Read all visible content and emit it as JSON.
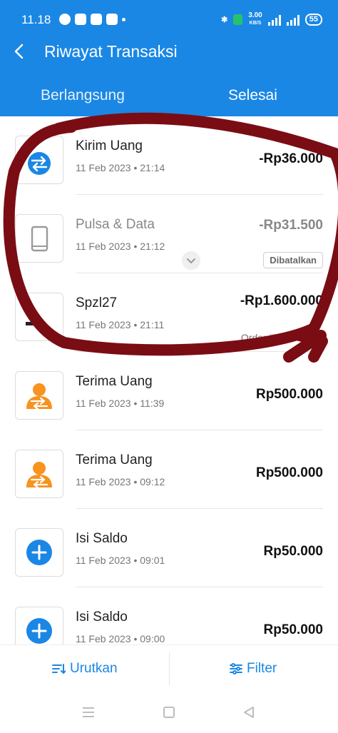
{
  "status": {
    "time": "11.18",
    "speed_top": "3.00",
    "speed_unit": "KB/S",
    "battery": "55"
  },
  "header": {
    "title": "Riwayat Transaksi",
    "tabs": [
      {
        "label": "Berlangsung"
      },
      {
        "label": "Selesai"
      }
    ]
  },
  "transactions": [
    {
      "name": "Kirim Uang",
      "date": "11 Feb 2023 • 21:14",
      "amount": "-Rp36.000",
      "icon": "transfer-send-icon"
    },
    {
      "name": "Pulsa & Data",
      "date": "11 Feb 2023 • 21:12",
      "amount": "-Rp31.500",
      "status": "Dibatalkan",
      "icon": "phone-icon"
    },
    {
      "name": "Spzl27",
      "date": "11 Feb 2023 • 21:11",
      "amount": "-Rp1.600.000",
      "order_id": "Order ID : ••• e2b6",
      "icon": "merchant-icon"
    },
    {
      "name": "Terima Uang",
      "date": "11 Feb 2023 • 11:39",
      "amount": "Rp500.000",
      "icon": "receive-money-icon"
    },
    {
      "name": "Terima Uang",
      "date": "11 Feb 2023 • 09:12",
      "amount": "Rp500.000",
      "icon": "receive-money-icon"
    },
    {
      "name": "Isi Saldo",
      "date": "11 Feb 2023 • 09:01",
      "amount": "Rp50.000",
      "icon": "top-up-icon"
    },
    {
      "name": "Isi Saldo",
      "date": "11 Feb 2023 • 09:00",
      "amount": "Rp50.000",
      "icon": "top-up-icon"
    }
  ],
  "bottom": {
    "sort_label": "Urutkan",
    "filter_label": "Filter"
  },
  "colors": {
    "brand": "#1a87e5",
    "orange": "#f7931e",
    "annotation": "#7a0d14"
  }
}
